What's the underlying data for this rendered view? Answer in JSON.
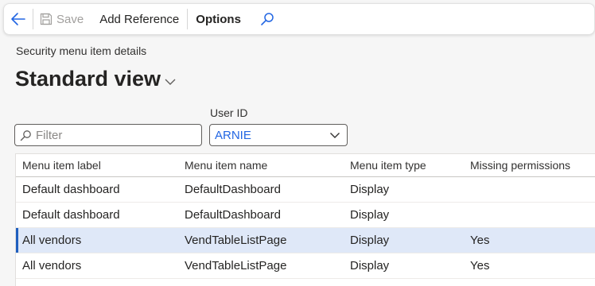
{
  "toolbar": {
    "save_label": "Save",
    "add_reference_label": "Add Reference",
    "options_label": "Options"
  },
  "page": {
    "caption": "Security menu item details",
    "view_name": "Standard view"
  },
  "filters": {
    "filter_placeholder": "Filter",
    "user_id_label": "User ID",
    "user_id_value": "ARNIE"
  },
  "grid": {
    "columns": [
      "Menu item label",
      "Menu item name",
      "Menu item type",
      "Missing permissions"
    ],
    "rows": [
      [
        "Default dashboard",
        "DefaultDashboard",
        "Display",
        ""
      ],
      [
        "Default dashboard",
        "DefaultDashboard",
        "Display",
        ""
      ],
      [
        "All vendors",
        "VendTableListPage",
        "Display",
        "Yes"
      ],
      [
        "All vendors",
        "VendTableListPage",
        "Display",
        "Yes"
      ]
    ],
    "selected_row": 2
  },
  "colors": {
    "accent": "#2266e3",
    "selection": "#dfe8f8",
    "selection_bar": "#1f5fbf"
  }
}
